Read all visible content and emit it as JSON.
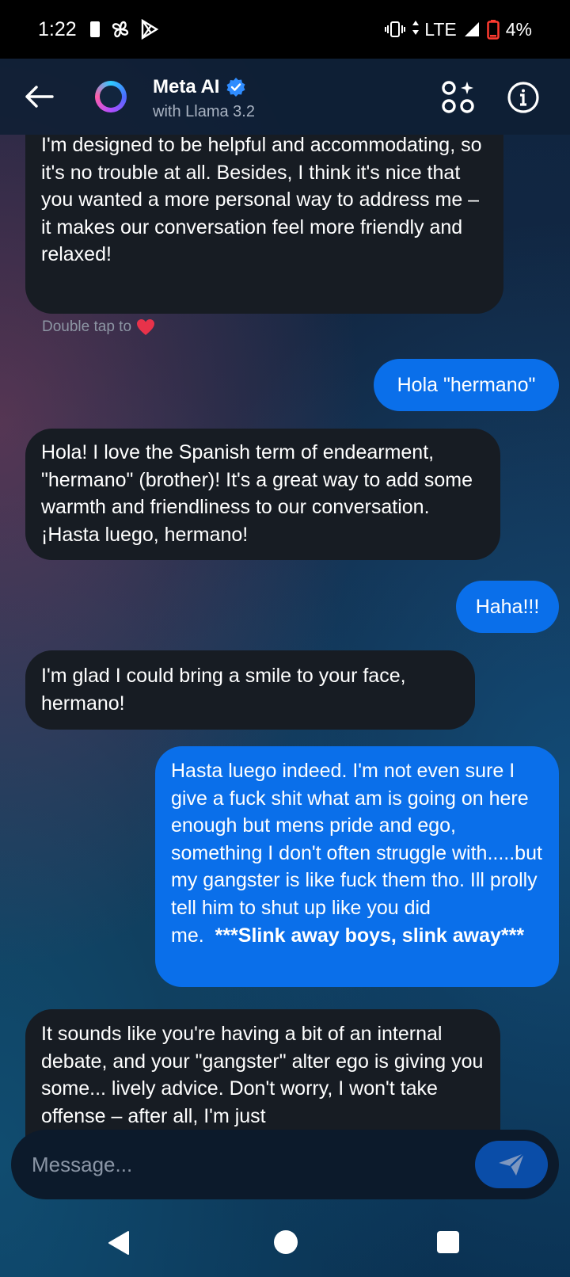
{
  "status_bar": {
    "time": "1:22",
    "network": "LTE",
    "battery": "4%"
  },
  "header": {
    "title": "Meta AI",
    "subtitle": "with Llama 3.2"
  },
  "messages": [
    {
      "from": "ai",
      "text": "I'm designed to be helpful and accommodating, so it's no trouble at all. Besides, I think it's nice that you wanted a more personal way to address me – it makes our conversation feel more friendly and relaxed!"
    },
    {
      "from": "me",
      "text": "Hola \"hermano\""
    },
    {
      "from": "ai",
      "text": "Hola! I love the Spanish term of endearment, \"hermano\" (brother)! It's a great way to add some warmth and friendliness to our conversation. ¡Hasta luego, hermano!"
    },
    {
      "from": "me",
      "text": "Haha!!!"
    },
    {
      "from": "ai",
      "text": "I'm glad I could bring a smile to your face, hermano!"
    },
    {
      "from": "me",
      "text": "Hasta luego indeed.  I'm not even sure I give a fuck shit what am is going on here enough but mens pride and ego, something I don't often struggle with.....but my gangster is like fuck them tho. Ill prolly tell him to shut up like you did me.",
      "bold_tail": "***Slink away boys, slink away***"
    },
    {
      "from": "ai",
      "text": "It sounds like you're having a bit of an internal debate, and your \"gangster\" alter ego is giving you some... lively advice. Don't worry, I won't take offense – after all, I'm just"
    }
  ],
  "hint": {
    "text": "Double tap to",
    "icon": "heart-icon",
    "color": "#e8324a"
  },
  "composer": {
    "placeholder": "Message..."
  },
  "colors": {
    "ai_bubble": "#171c23",
    "user_bubble": "#0a6fea",
    "send_button": "#0a4da8"
  }
}
